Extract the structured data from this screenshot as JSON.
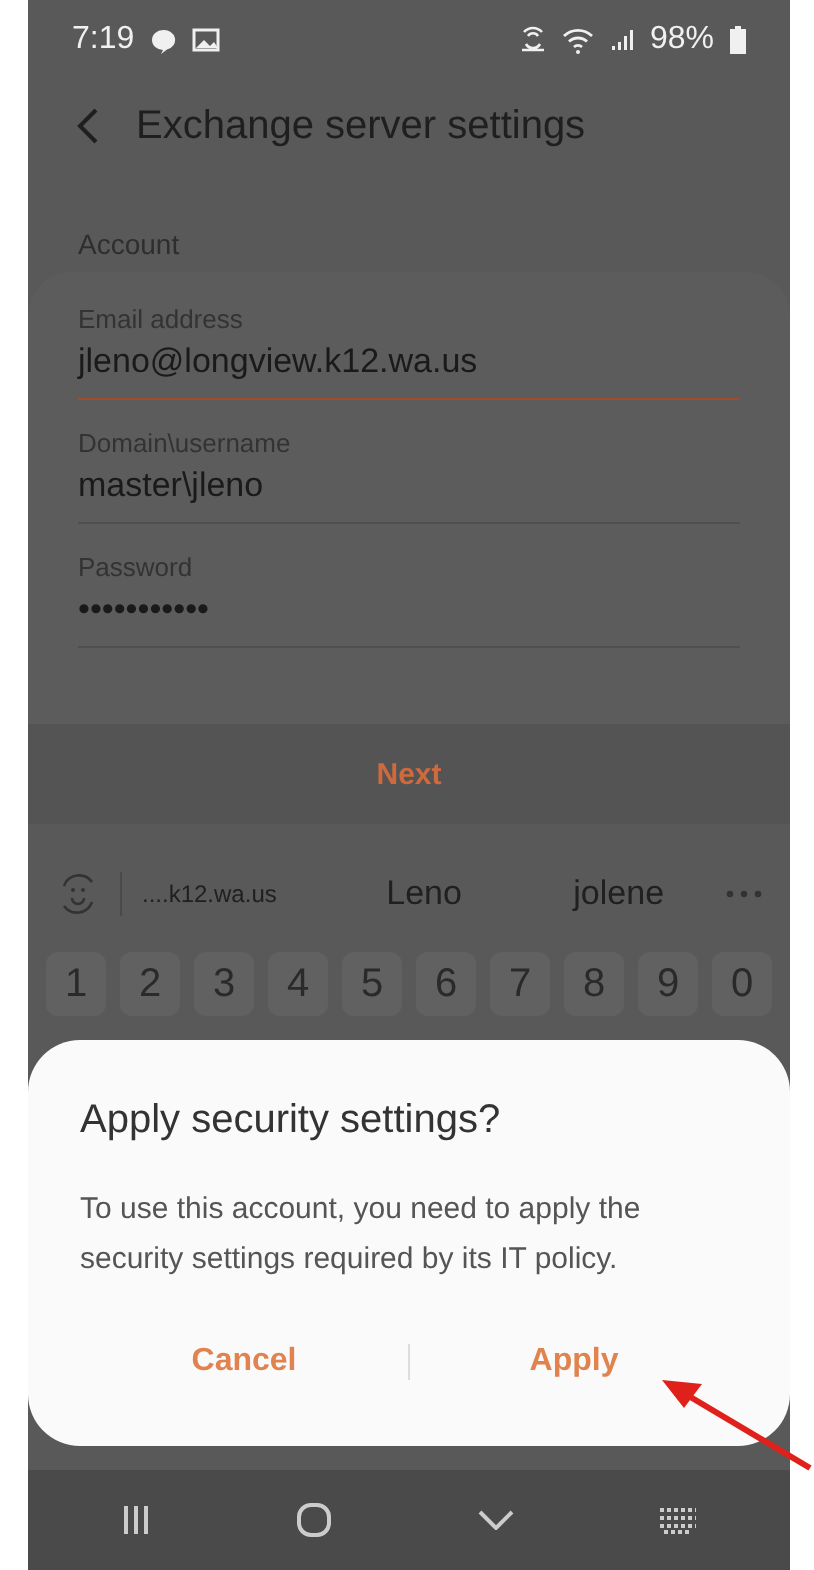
{
  "status_bar": {
    "time": "7:19",
    "battery": "98%"
  },
  "header": {
    "title": "Exchange server settings"
  },
  "section": "Account",
  "fields": [
    {
      "label": "Email address",
      "value": "jleno@longview.k12.wa.us",
      "focused": true
    },
    {
      "label": "Domain\\username",
      "value": "master\\jleno",
      "focused": false
    },
    {
      "label": "Password",
      "value": "•••••••••••",
      "focused": false
    }
  ],
  "next_button": "Next",
  "keyboard": {
    "suggestions": [
      "....k12.wa.us",
      "Leno",
      "jolene"
    ],
    "number_keys": [
      "1",
      "2",
      "3",
      "4",
      "5",
      "6",
      "7",
      "8",
      "9",
      "0"
    ]
  },
  "dialog": {
    "title": "Apply security settings?",
    "message": "To use this account, you need to apply the security settings required by its IT policy.",
    "buttons": [
      "Cancel",
      "Apply"
    ]
  }
}
